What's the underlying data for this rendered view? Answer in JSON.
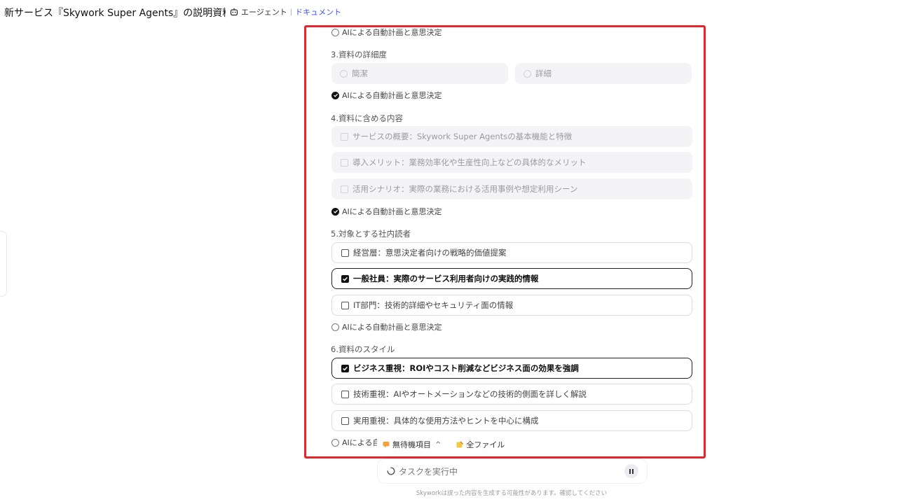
{
  "header": {
    "title": "新サービス『Skywork Super Agents』の説明資料",
    "agent_label": "エージェント",
    "doc_label": "ドキュメント"
  },
  "panel": {
    "top_partial_label": "AIによる自動計画と意思決定",
    "q3": {
      "title": "3.資料の詳細度",
      "options": [
        "簡潔",
        "詳細"
      ],
      "ai_label": "AIによる自動計画と意思決定"
    },
    "q4": {
      "title": "4.資料に含める内容",
      "options": [
        "サービスの概要：Skywork Super Agentsの基本機能と特徴",
        "導入メリット：業務効率化や生産性向上などの具体的なメリット",
        "活用シナリオ：実際の業務における活用事例や想定利用シーン"
      ],
      "ai_label": "AIによる自動計画と意思決定"
    },
    "q5": {
      "title": "5.対象とする社内読者",
      "options": [
        "経営層：意思決定者向けの戦略的価値提案",
        "一般社員：実際のサービス利用者向けの実践的情報",
        "IT部門：技術的詳細やセキュリティ面の情報"
      ],
      "ai_label": "AIによる自動計画と意思決定"
    },
    "q6": {
      "title": "6.資料のスタイル",
      "options": [
        "ビジネス重視：ROIやコスト削減などビジネス面の効果を強調",
        "技術重視：AIやオートメーションなどの技術的側面を詳しく解説",
        "実用重視：具体的な使用方法やヒントを中心に構成"
      ],
      "ai_label_partial": "AIによる自"
    }
  },
  "bottom_bar": {
    "pending_label": "無待機項目",
    "files_label": "全ファイル"
  },
  "task": {
    "label": "タスクを実行中"
  },
  "disclaimer": "Skyworkは誤った内容を生成する可能性があります。確認してください",
  "colors": {
    "highlight_border": "#e8242c",
    "link": "#3a52ff"
  }
}
